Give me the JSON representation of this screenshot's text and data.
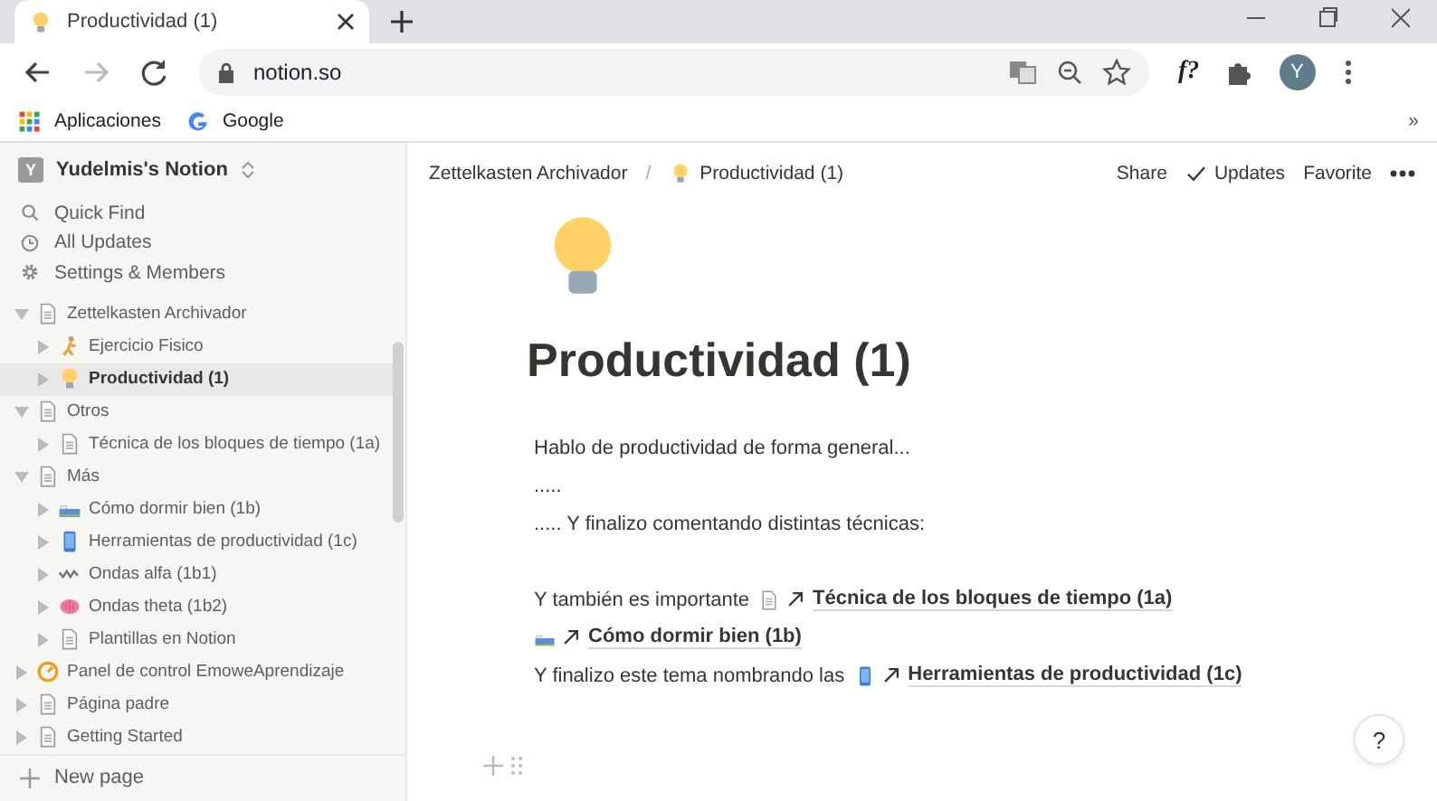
{
  "browser": {
    "tab": {
      "title": "Productividad (1)"
    },
    "address": "notion.so",
    "extension_label": "f?",
    "avatar": "Y",
    "bookmarks": [
      {
        "kind": "apps",
        "label": "Aplicaciones"
      },
      {
        "kind": "google",
        "label": "Google"
      }
    ],
    "bookmarks_overflow": "»"
  },
  "sidebar": {
    "workspace": {
      "badge": "Y",
      "name": "Yudelmis's Notion"
    },
    "menu": [
      {
        "kind": "search",
        "label": "Quick Find"
      },
      {
        "kind": "clock",
        "label": "All Updates"
      },
      {
        "kind": "gear",
        "label": "Settings & Members"
      }
    ],
    "pages": [
      {
        "kind": "page",
        "title": "Zettelkasten Archivador",
        "expanded": true,
        "selected": false,
        "children": [
          {
            "kind": "runner",
            "title": "Ejercicio Fisico",
            "expanded": false,
            "selected": false
          },
          {
            "kind": "bulb",
            "title": "Productividad (1)",
            "expanded": false,
            "selected": true
          }
        ]
      },
      {
        "kind": "page",
        "title": "Otros",
        "expanded": true,
        "selected": false,
        "children": [
          {
            "kind": "page",
            "title": "Técnica de los bloques de tiempo (1a)",
            "expanded": false,
            "selected": false
          }
        ]
      },
      {
        "kind": "page",
        "title": "Más",
        "expanded": true,
        "selected": false,
        "children": [
          {
            "kind": "bed",
            "title": "Cómo dormir bien (1b)",
            "expanded": false,
            "selected": false
          },
          {
            "kind": "phone",
            "title": "Herramientas de productividad (1c)",
            "expanded": false,
            "selected": false
          },
          {
            "kind": "wave",
            "title": "Ondas alfa (1b1)",
            "expanded": false,
            "selected": false
          },
          {
            "kind": "brain",
            "title": "Ondas theta (1b2)",
            "expanded": false,
            "selected": false
          },
          {
            "kind": "page",
            "title": "Plantillas en Notion",
            "expanded": false,
            "selected": false
          }
        ]
      },
      {
        "kind": "gauge",
        "title": "Panel de control EmoweAprendizaje",
        "expanded": false,
        "selected": false
      },
      {
        "kind": "page",
        "title": "Página padre",
        "expanded": false,
        "selected": false
      },
      {
        "kind": "page",
        "title": "Getting Started",
        "expanded": false,
        "selected": false
      }
    ],
    "new_page": "New page"
  },
  "page": {
    "breadcrumbs": [
      {
        "kind": "plain",
        "label": "Zettelkasten Archivador"
      },
      {
        "kind": "bulb",
        "label": "Productividad (1)"
      }
    ],
    "separator": "/",
    "actions": [
      {
        "kind": "plain",
        "label": "Share"
      },
      {
        "kind": "check",
        "label": "Updates"
      },
      {
        "kind": "plain",
        "label": "Favorite"
      }
    ],
    "title": "Productividad (1)",
    "blocks": [
      {
        "kind": "text",
        "segments": [
          {
            "kind": "text",
            "text": "Hablo de productividad de forma general..."
          }
        ]
      },
      {
        "kind": "text",
        "segments": [
          {
            "kind": "text",
            "text": "....."
          }
        ]
      },
      {
        "kind": "text",
        "segments": [
          {
            "kind": "text",
            "text": "..... Y finalizo comentando distintas técnicas:"
          }
        ]
      },
      {
        "kind": "blank"
      },
      {
        "kind": "text",
        "segments": [
          {
            "kind": "text",
            "text": "Y también es importante"
          },
          {
            "kind": "link",
            "text": "Técnica de los bloques de tiempo (1a)"
          }
        ]
      },
      {
        "kind": "text",
        "segments": [
          {
            "kind": "link",
            "text": "Cómo dormir bien (1b)"
          }
        ]
      },
      {
        "kind": "text",
        "segments": [
          {
            "kind": "text",
            "text": "Y finalizo este tema nombrando las"
          },
          {
            "kind": "link",
            "text": "Herramientas de productividad (1c)"
          }
        ]
      }
    ],
    "help": "?"
  }
}
